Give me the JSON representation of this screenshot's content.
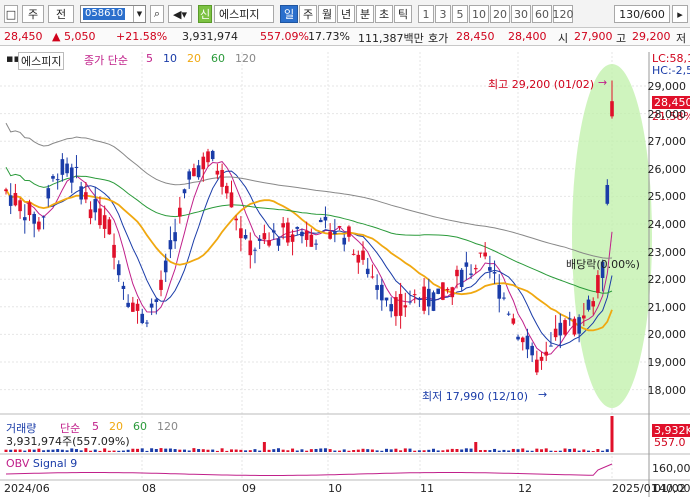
{
  "toolbar": {
    "type_label": "주",
    "period_label": "전",
    "code": "058610",
    "company_badge": "신",
    "company": "에스피지",
    "periods": [
      "일",
      "주",
      "월",
      "년",
      "분",
      "초",
      "틱"
    ],
    "active_period": "일",
    "intervals": [
      "1",
      "3",
      "5",
      "10",
      "20",
      "30",
      "60",
      "120"
    ],
    "count": "130/600",
    "ambiguous_top_icon": "□"
  },
  "quote": {
    "price": "28,450",
    "change": "▲ 5,050",
    "change_pct": "+21.58%",
    "volume": "3,931,974",
    "volume_pct": "557.09%",
    "turnover": "17.73%",
    "amount": "111,387백만",
    "bid_label": "호가",
    "bid": "28,450",
    "ask": "28,400",
    "open_label": "시",
    "open": "27,900",
    "high_label": "고",
    "high": "29,200",
    "low_label": "저"
  },
  "chart": {
    "title": "에스피지",
    "ma_label": "종가 단순",
    "ma_periods": [
      "5",
      "10",
      "20",
      "60",
      "120"
    ],
    "ma_colors": [
      "#c0208a",
      "#1a3ca8",
      "#f0a810",
      "#2a9a3a",
      "#888888"
    ],
    "lc_label": "LC:58,1",
    "hc_label": "HC:-2,5",
    "high_annotation": "최고 29,200 (01/02)",
    "low_annotation": "최저 17,990 (12/10)",
    "dividend_annotation": "배당락(0.00%)",
    "current_price_tag": "28,450",
    "current_pct_tag": "21.58%",
    "up_color": "#e0102a",
    "down_color": "#1a3ca8",
    "highlight_color": "#bff0a8",
    "y_ticks": [
      "29,000",
      "28,000",
      "27,000",
      "26,000",
      "25,000",
      "24,000",
      "23,000",
      "22,000",
      "21,000",
      "20,000",
      "19,000",
      "18,000"
    ],
    "x_ticks": [
      "2024/06",
      "08",
      "09",
      "10",
      "11",
      "12",
      "2025/01",
      "01/02"
    ]
  },
  "volume_panel": {
    "label": "거래량",
    "ma_label": "단순",
    "ma_periods": [
      "5",
      "20",
      "60",
      "120"
    ],
    "value_line": "3,931,974주(557.09%)",
    "tag_value": "3,932K",
    "tag_pct": "557.0"
  },
  "obv_panel": {
    "label": "OBV",
    "signal_label": "Signal 9",
    "tag_value": "160,00",
    "tag_value2": "140,00"
  }
}
